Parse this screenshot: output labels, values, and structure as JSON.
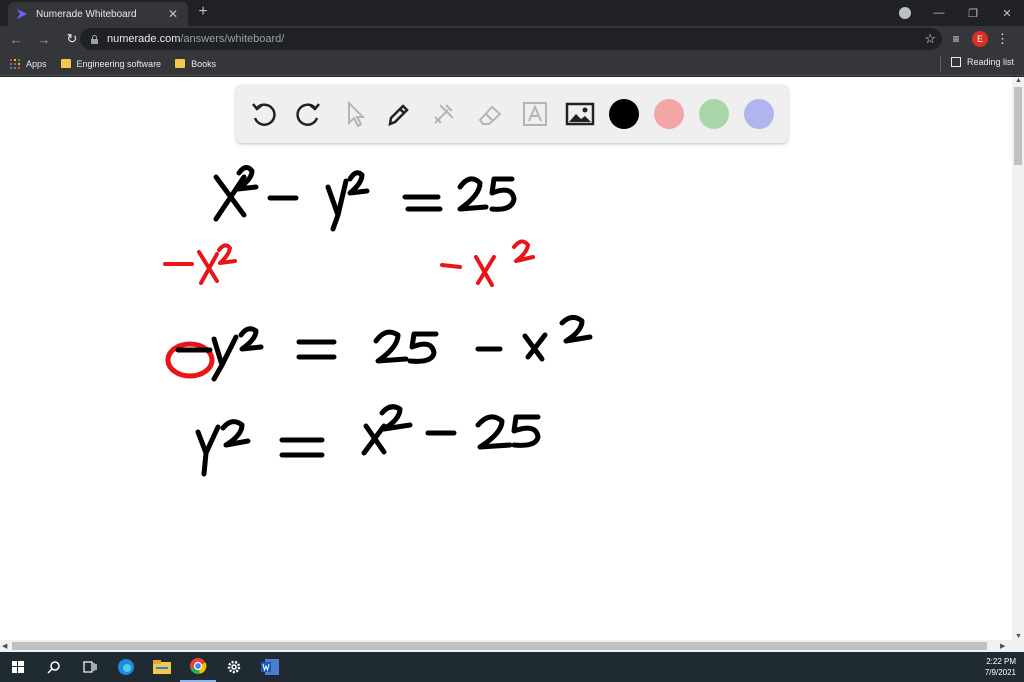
{
  "browser": {
    "tab_title": "Numerade Whiteboard",
    "url_host": "numerade.com",
    "url_path": "/answers/whiteboard/",
    "avatar_letter": "E"
  },
  "bookmarks": {
    "apps_label": "Apps",
    "items": [
      "Engineering software",
      "Books"
    ],
    "reading_list_label": "Reading list"
  },
  "whiteboard": {
    "tools": [
      "undo-icon",
      "redo-icon",
      "select-pointer-icon",
      "pen-icon",
      "tools-icon",
      "eraser-icon",
      "text-box-icon",
      "image-icon"
    ],
    "colors": [
      "#000000",
      "#f4a6a6",
      "#a9d6a9",
      "#b0b4ef"
    ],
    "ink_colors": {
      "black": "#000000",
      "red": "#e8141a"
    },
    "handwriting": [
      {
        "text": "x² − y² = 25",
        "ink": "black"
      },
      {
        "text": "−x²",
        "ink": "red"
      },
      {
        "text": "−x²",
        "ink": "red"
      },
      {
        "text": "−y² = 25 − x²",
        "ink": "black"
      },
      {
        "text": "y² = x² − 25",
        "ink": "black"
      }
    ]
  },
  "taskbar": {
    "time": "2:22 PM",
    "date": "7/9/2021"
  }
}
